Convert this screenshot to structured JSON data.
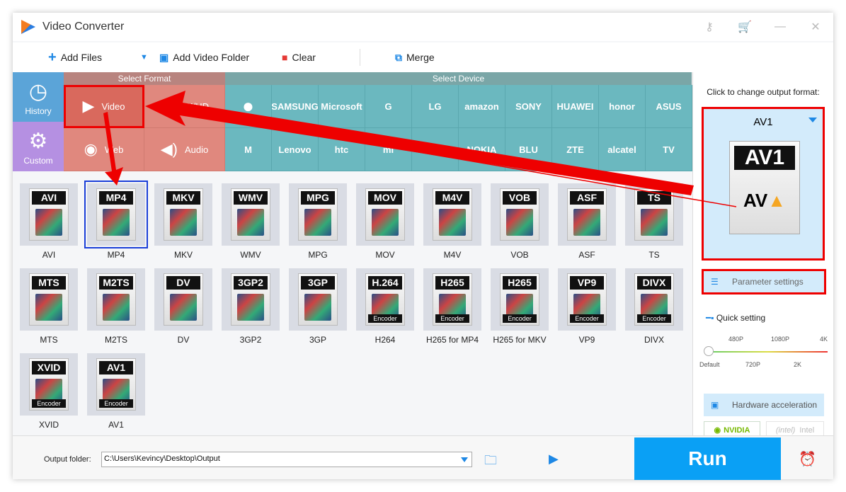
{
  "app": {
    "title": "Video Converter",
    "icons": [
      "key-icon",
      "cart-icon",
      "minimize-icon",
      "close-icon"
    ]
  },
  "toolbar": {
    "add_files": "Add Files",
    "add_folder": "Add Video Folder",
    "clear": "Clear",
    "merge": "Merge"
  },
  "sidebar": {
    "history": "History",
    "custom": "Custom"
  },
  "select_format": {
    "header": "Select Format",
    "items": [
      "Video",
      "4K/HD",
      "Web",
      "Audio"
    ],
    "active": "Video"
  },
  "select_device": {
    "header": "Select Device",
    "row1": [
      "",
      "SAMSUNG",
      "Microsoft",
      "G",
      "LG",
      "amazon",
      "SONY",
      "HUAWEI",
      "honor",
      "ASUS"
    ],
    "row2": [
      "M",
      "Lenovo",
      "htc",
      "mi",
      "1+",
      "NOKIA",
      "BLU",
      "ZTE",
      "alcatel",
      "TV"
    ]
  },
  "formats": [
    {
      "label": "AVI",
      "badge": "AVI"
    },
    {
      "label": "MP4",
      "badge": "MP4",
      "selected": true
    },
    {
      "label": "MKV",
      "badge": "MKV"
    },
    {
      "label": "WMV",
      "badge": "WMV"
    },
    {
      "label": "MPG",
      "badge": "MPG"
    },
    {
      "label": "MOV",
      "badge": "MOV"
    },
    {
      "label": "M4V",
      "badge": "M4V"
    },
    {
      "label": "VOB",
      "badge": "VOB"
    },
    {
      "label": "ASF",
      "badge": "ASF"
    },
    {
      "label": "TS",
      "badge": "TS"
    },
    {
      "label": "MTS",
      "badge": "MTS"
    },
    {
      "label": "M2TS",
      "badge": "M2TS"
    },
    {
      "label": "DV",
      "badge": "DV"
    },
    {
      "label": "3GP2",
      "badge": "3GP2"
    },
    {
      "label": "3GP",
      "badge": "3GP"
    },
    {
      "label": "H264",
      "badge": "H.264",
      "enc": "Encoder"
    },
    {
      "label": "H265 for MP4",
      "badge": "H265",
      "enc": "Encoder"
    },
    {
      "label": "H265 for MKV",
      "badge": "H265",
      "enc": "Encoder"
    },
    {
      "label": "VP9",
      "badge": "VP9",
      "enc": "Encoder"
    },
    {
      "label": "DIVX",
      "badge": "DIVX",
      "enc": "Encoder"
    },
    {
      "label": "XVID",
      "badge": "XVID",
      "enc": "Encoder"
    },
    {
      "label": "AV1",
      "badge": "AV1",
      "enc": "Encoder"
    }
  ],
  "right": {
    "prompt": "Click to change output format:",
    "format": "AV1",
    "logo": "AV1",
    "param": "Parameter settings",
    "quick": "Quick setting",
    "ticks_top": [
      "480P",
      "1080P",
      "4K"
    ],
    "ticks_bottom": [
      "Default",
      "720P",
      "2K"
    ],
    "quality_value": "Default",
    "hw": "Hardware acceleration",
    "nvidia": "NVIDIA",
    "intel": "Intel"
  },
  "bottom": {
    "output_label": "Output folder:",
    "output_path": "C:\\Users\\Kevincy\\Desktop\\Output",
    "run": "Run"
  },
  "colors": {
    "accent": "#0aa0f5",
    "annotation": "#ee0000"
  }
}
